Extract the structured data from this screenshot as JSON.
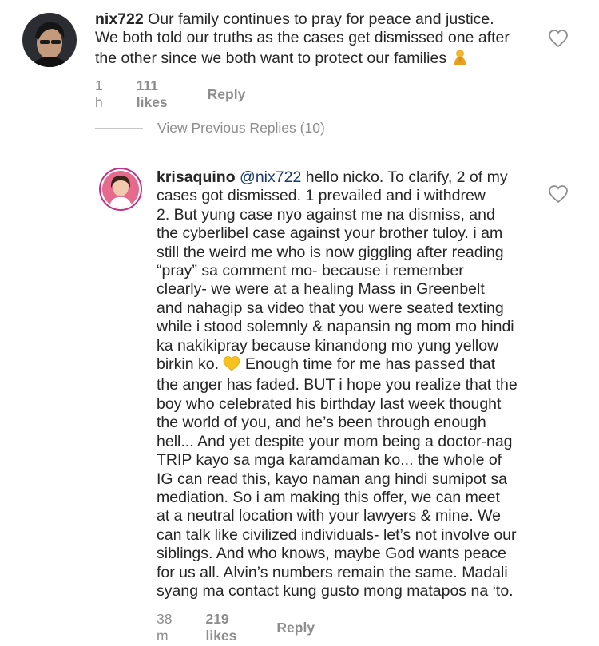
{
  "comment1": {
    "username": "nix722",
    "lines": [
      "Our family continues to pray for peace and justice.",
      "We both told our truths as the cases get dismissed one after",
      "the other since we both want to protect our families"
    ],
    "emoji": "praying-hands-emoji",
    "time": "1 h",
    "likes": "111 likes",
    "reply_label": "Reply"
  },
  "view_replies": {
    "label": "View Previous Replies (10)"
  },
  "comment2": {
    "username": "krisaquino",
    "mention": "@nix722",
    "first_line_rest": "hello nicko. To clarify, 2 of my",
    "lines": [
      "cases got dismissed. 1 prevailed and i withdrew",
      "2. But yung case nyo against me na dismiss, and",
      "the cyberlibel case against your brother tuloy. i am",
      "still the weird me who is now giggling after reading",
      "“pray” sa comment mo- because i remember",
      "clearly- we were at a healing Mass in Greenbelt",
      "and nahagip sa video that you were seated texting",
      "while i stood solemnly & napansin ng mom mo hindi",
      "ka nakikipray because kinandong mo yung yellow"
    ],
    "line_before_heart": "birkin ko.",
    "line_after_heart": "Enough time for me has passed that",
    "emoji": "yellow-heart-emoji",
    "lines_after": [
      "the anger has faded. BUT i hope you realize that the",
      "boy who celebrated his birthday last week thought",
      "the world of you, and he’s been through enough",
      "hell... And yet despite your mom being a doctor-nag",
      "TRIP kayo sa mga karamdaman ko... the whole of",
      "IG can read this, kayo naman ang hindi sumipot sa",
      "mediation. So i am making this offer, we can meet",
      "at a neutral location with your lawyers & mine. We",
      "can talk like civilized individuals- let’s not involve our",
      "siblings. And who knows, maybe God wants peace",
      "for us all. Alvin’s numbers remain the same. Madali",
      "syang ma contact kung gusto mong matapos na ‘to."
    ],
    "time": "38 m",
    "likes": "219 likes",
    "reply_label": "Reply"
  },
  "colors": {
    "text": "#262626",
    "muted": "#8e8e8e",
    "mention": "#1a3a6b",
    "avatar_ring": "#c13584"
  }
}
